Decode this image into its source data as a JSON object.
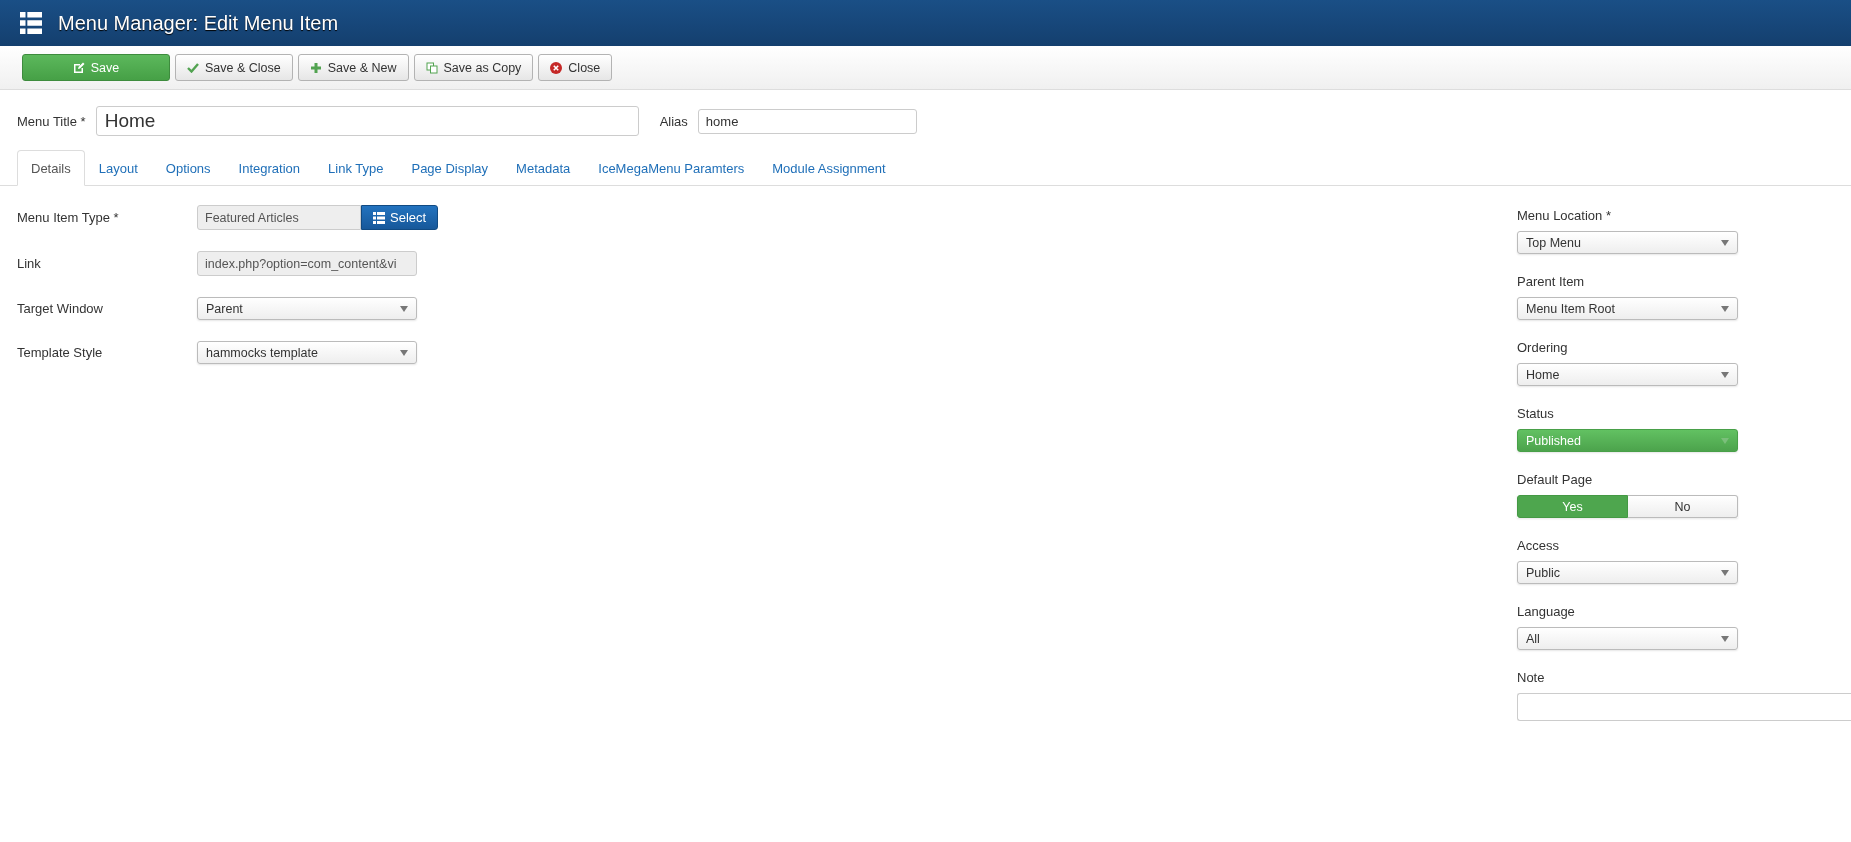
{
  "header": {
    "title": "Menu Manager: Edit Menu Item"
  },
  "toolbar": [
    {
      "label": "Save",
      "kind": "primary"
    },
    {
      "label": "Save & Close",
      "kind": "default"
    },
    {
      "label": "Save & New",
      "kind": "default"
    },
    {
      "label": "Save as Copy",
      "kind": "default"
    },
    {
      "label": "Close",
      "kind": "default"
    }
  ],
  "title_row": {
    "title_label": "Menu Title *",
    "title_value": "Home",
    "alias_label": "Alias",
    "alias_value": "home"
  },
  "tabs": [
    {
      "label": "Details",
      "selected": true
    },
    {
      "label": "Layout",
      "selected": false
    },
    {
      "label": "Options",
      "selected": false
    },
    {
      "label": "Integration",
      "selected": false
    },
    {
      "label": "Link Type",
      "selected": false
    },
    {
      "label": "Page Display",
      "selected": false
    },
    {
      "label": "Metadata",
      "selected": false
    },
    {
      "label": "IceMegaMenu Paramters",
      "selected": false
    },
    {
      "label": "Module Assignment",
      "selected": false
    }
  ],
  "details": [
    {
      "label": "Menu Item Type *",
      "kind": "picker",
      "value": "Featured Articles",
      "button": "Select"
    },
    {
      "label": "Link",
      "kind": "readonly",
      "value": "index.php?option=com_content&vi"
    },
    {
      "label": "Target Window",
      "kind": "select",
      "value": "Parent"
    },
    {
      "label": "Template Style",
      "kind": "select",
      "value": "hammocks template"
    }
  ],
  "sidebar": [
    {
      "label": "Menu Location *",
      "kind": "select",
      "value": "Top Menu"
    },
    {
      "label": "Parent Item",
      "kind": "select",
      "value": "Menu Item Root"
    },
    {
      "label": "Ordering",
      "kind": "select",
      "value": "Home"
    },
    {
      "label": "Status",
      "kind": "status",
      "value": "Published"
    },
    {
      "label": "Default Page",
      "kind": "toggle",
      "options": [
        {
          "label": "Yes",
          "selected": true
        },
        {
          "label": "No",
          "selected": false
        }
      ]
    },
    {
      "label": "Access",
      "kind": "select",
      "value": "Public"
    },
    {
      "label": "Language",
      "kind": "select",
      "value": "All"
    },
    {
      "label": "Note",
      "kind": "text"
    }
  ]
}
